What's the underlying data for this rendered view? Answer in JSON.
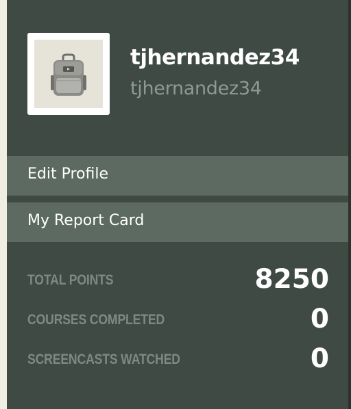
{
  "profile": {
    "display_name": "tjhernandez34",
    "username": "tjhernandez34",
    "avatar_icon": "backpack-icon"
  },
  "menu": {
    "items": [
      {
        "label": "Edit Profile"
      },
      {
        "label": "My Report Card"
      }
    ]
  },
  "stats": [
    {
      "label": "TOTAL POINTS",
      "value": "8250"
    },
    {
      "label": "COURSES COMPLETED",
      "value": "0"
    },
    {
      "label": "SCREENCASTS WATCHED",
      "value": "0"
    }
  ],
  "colors": {
    "panel_background": "#3f4a44",
    "menu_background": "#5c6a62",
    "muted_text": "#7b8a82",
    "page_background": "#f0ede3"
  }
}
